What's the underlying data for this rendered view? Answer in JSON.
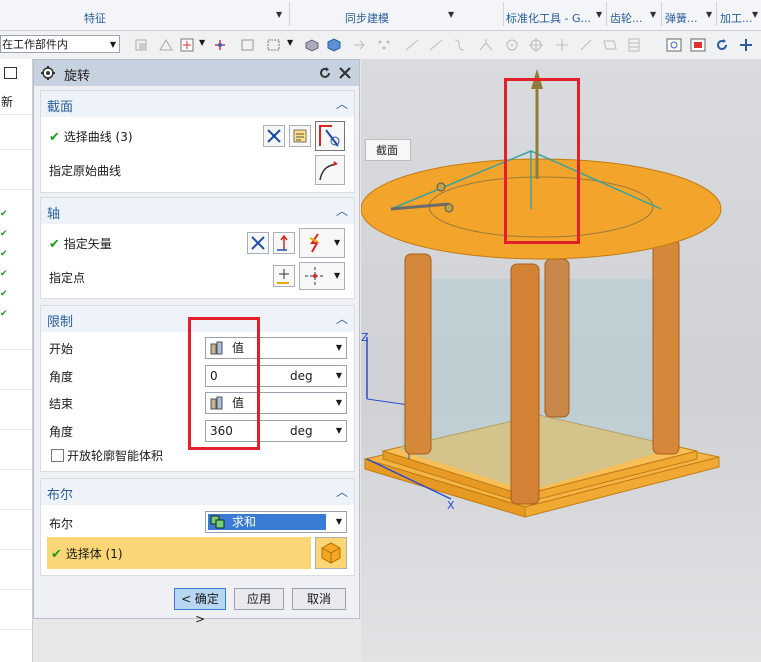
{
  "ribbon": {
    "groups": [
      {
        "label": "特征"
      },
      {
        "label": "同步建模"
      },
      {
        "label": "标准化工具 - G..."
      },
      {
        "label": "齿轮..."
      },
      {
        "label": "弹簧..."
      },
      {
        "label": "加工..."
      }
    ]
  },
  "toolbar": {
    "work_part_select": "在工作部件内"
  },
  "left_strip": {
    "header_text": "新"
  },
  "dialog": {
    "title": "旋转",
    "section_section": {
      "title": "截面",
      "select_curve": "选择曲线 (3)",
      "specify_origin_curve": "指定原始曲线"
    },
    "section_axis": {
      "title": "轴",
      "specify_vector": "指定矢量",
      "specify_point": "指定点"
    },
    "section_limits": {
      "title": "限制",
      "start_label": "开始",
      "start_value": "值",
      "angle1_label": "角度",
      "angle1_value": "0",
      "angle1_unit": "deg",
      "end_label": "结束",
      "end_value": "值",
      "angle2_label": "角度",
      "angle2_value": "360",
      "angle2_unit": "deg",
      "open_profile_label": "开放轮廓智能体积"
    },
    "section_boolean": {
      "title": "布尔",
      "boolean_label": "布尔",
      "boolean_value": "求和",
      "select_body": "选择体 (1)"
    },
    "buttons": {
      "ok": "< 确定 >",
      "apply": "应用",
      "cancel": "取消"
    }
  },
  "viewport": {
    "tooltip": "截面",
    "axis_x": "X",
    "axis_z": "Z"
  },
  "colors": {
    "accent_blue": "#2a5d9c",
    "check_green": "#1aa01a",
    "highlight_red": "#e3202a",
    "body_orange": "#f0a326",
    "selected_row": "#fbd677"
  }
}
